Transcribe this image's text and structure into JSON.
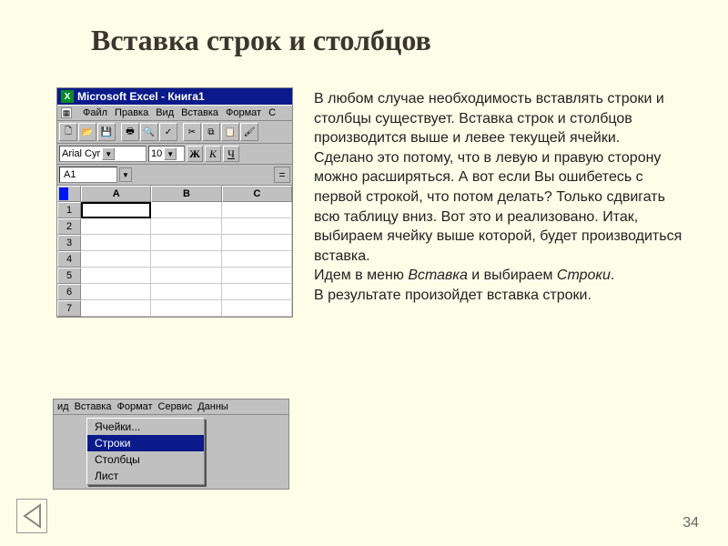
{
  "slide": {
    "title": "Вставка строк и столбцов",
    "page_number": "34"
  },
  "paragraphs": {
    "p1": "В любом случае необходимость вставлять строки и столбцы существует. Вставка строк и столбцов производится выше и левее текущей ячейки.",
    "p2": "Сделано это потому, что в левую и правую сторону можно расширяться. А вот если Вы ошибетесь с первой строкой, что потом делать? Только сдвигать всю таблицу вниз. Вот это и реализовано. Итак, выбираем ячейку выше которой, будет производиться вставка.",
    "p3a": "Идем в меню ",
    "p3b": "Вставка",
    "p3c": " и выбираем ",
    "p3d": "Строки",
    "p3e": ".",
    "p4": "В результате произойдет вставка строки."
  },
  "excel": {
    "title": "Microsoft Excel - Книга1",
    "menu": {
      "file": "Файл",
      "edit": "Правка",
      "view": "Вид",
      "insert": "Вставка",
      "format": "Формат",
      "tools": "С"
    },
    "font_name": "Arial Cyr",
    "font_size": "10",
    "bold": "Ж",
    "italic": "К",
    "underline": "Ч",
    "namebox": "A1",
    "eq": "=",
    "cols": [
      "A",
      "B",
      "C"
    ],
    "rows": [
      "1",
      "2",
      "3",
      "4",
      "5",
      "6",
      "7"
    ]
  },
  "menu_snap": {
    "menubar": {
      "m1": "ид",
      "m2": "Вставка",
      "m3": "Формат",
      "m4": "Сервис",
      "m5": "Данны"
    },
    "items": {
      "cells": "Ячейки...",
      "rows": "Строки",
      "cols": "Столбцы",
      "sheet": "Лист"
    }
  }
}
